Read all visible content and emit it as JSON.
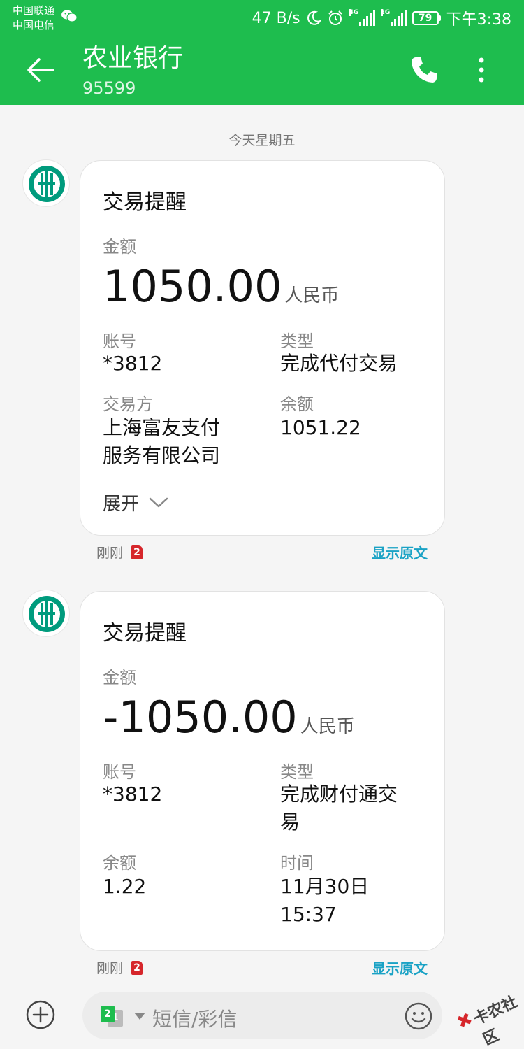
{
  "status_bar": {
    "carrier_1": "中国联通",
    "carrier_2": "中国电信",
    "net_speed": "47 B/s",
    "sim1_net": "4G",
    "sim2_net": "2G",
    "battery": "79",
    "time": "下午3:38"
  },
  "header": {
    "title": "农业银行",
    "number": "95599",
    "bg_color": "#1ebd4e"
  },
  "thread": {
    "date_separator": "今天星期五",
    "messages": [
      {
        "card_title": "交易提醒",
        "amount_label": "金额",
        "amount": "1050.00",
        "currency": "人民币",
        "fields": [
          {
            "label": "账号",
            "value": "*3812"
          },
          {
            "label": "类型",
            "value": "完成代付交易"
          },
          {
            "label": "交易方",
            "value": "上海富友支付\n服务有限公司"
          },
          {
            "label": "余额",
            "value": "1051.22"
          }
        ],
        "expand_label": "展开",
        "time": "刚刚",
        "sim": "2",
        "show_original": "显示原文"
      },
      {
        "card_title": "交易提醒",
        "amount_label": "金额",
        "amount": "-1050.00",
        "currency": "人民币",
        "fields": [
          {
            "label": "账号",
            "value": "*3812"
          },
          {
            "label": "类型",
            "value": "完成财付通交\n易"
          },
          {
            "label": "余额",
            "value": "1.22"
          },
          {
            "label": "时间",
            "value": "11月30日\n15:37"
          }
        ],
        "time": "刚刚",
        "sim": "2",
        "show_original": "显示原文"
      }
    ]
  },
  "composer": {
    "sim_active": "2",
    "sim_inactive": "1",
    "placeholder": "短信/彩信"
  },
  "watermark": {
    "text": "卡农社区"
  },
  "icons": {
    "back": "arrow-left-icon",
    "call": "phone-icon",
    "more": "more-vertical-icon",
    "avatar": "abc-bank-logo-icon",
    "expand": "chevron-down-icon",
    "add": "plus-circle-icon",
    "emoji": "smiley-icon"
  },
  "accent_color": "#1aa2c5"
}
